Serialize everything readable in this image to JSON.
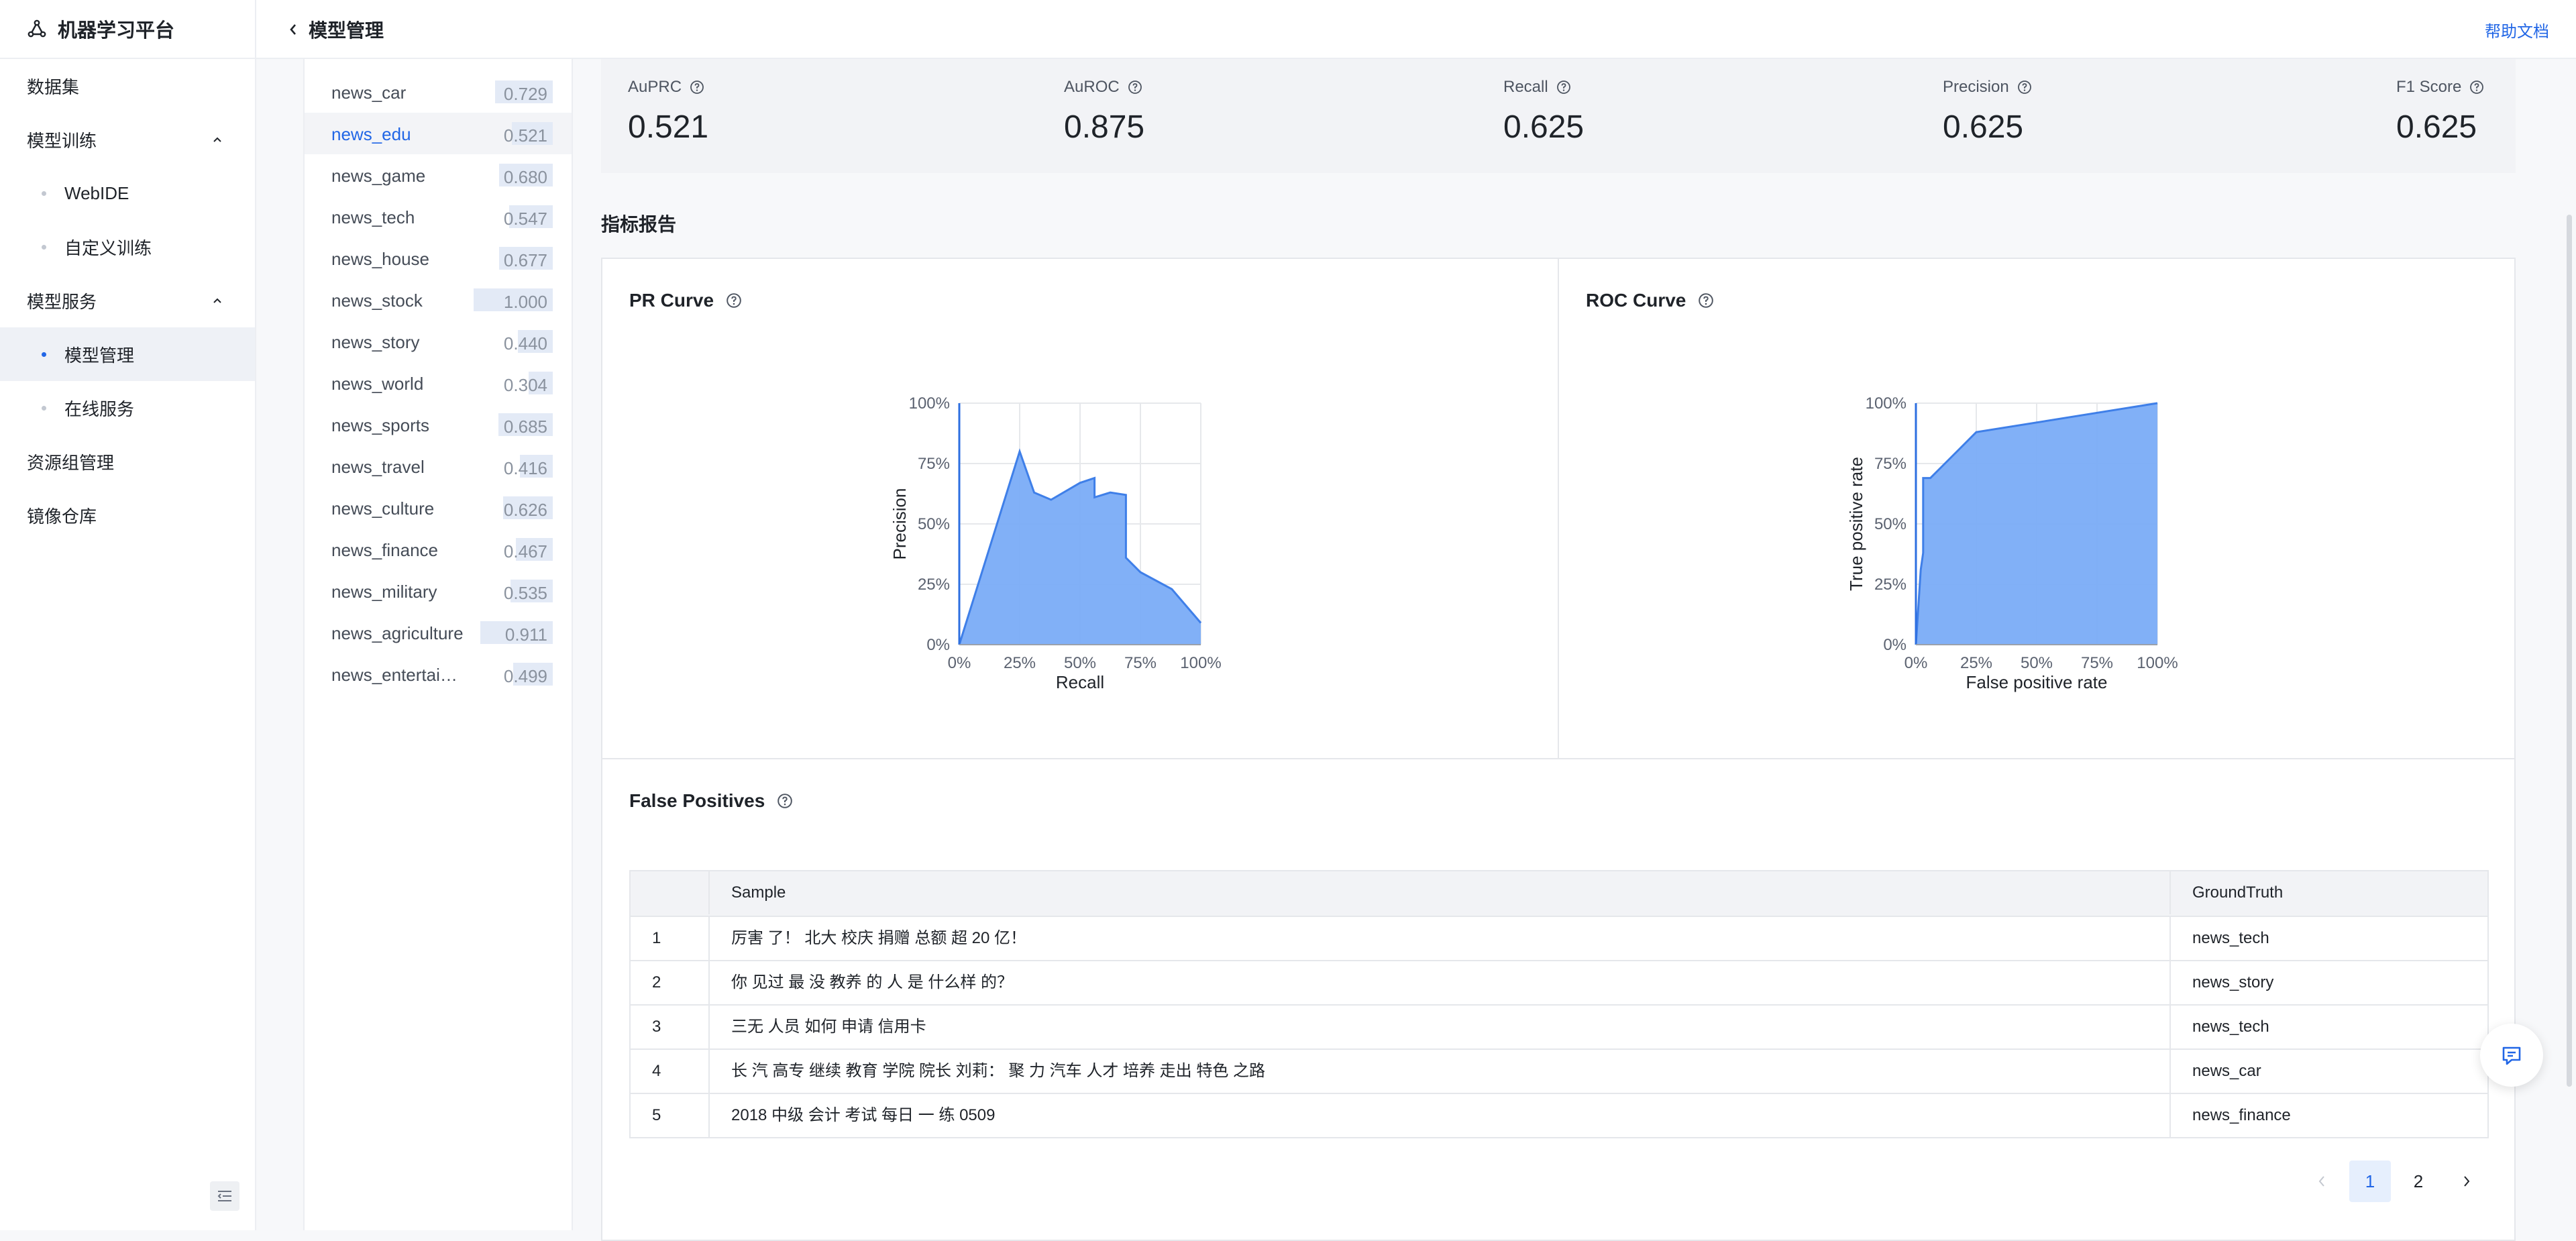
{
  "app": {
    "title": "机器学习平台"
  },
  "nav": {
    "items": [
      {
        "label": "数据集",
        "level": "top"
      },
      {
        "label": "模型训练",
        "level": "top",
        "expanded": true
      },
      {
        "label": "WebIDE",
        "level": "sub"
      },
      {
        "label": "自定义训练",
        "level": "sub"
      },
      {
        "label": "模型服务",
        "level": "top",
        "expanded": true
      },
      {
        "label": "模型管理",
        "level": "sub",
        "active": true
      },
      {
        "label": "在线服务",
        "level": "sub"
      },
      {
        "label": "资源组管理",
        "level": "top"
      },
      {
        "label": "镜像仓库",
        "level": "top"
      }
    ]
  },
  "header": {
    "title": "模型管理",
    "help": "帮助文档"
  },
  "categories": [
    {
      "name": "news_car",
      "value": "0.729"
    },
    {
      "name": "news_edu",
      "value": "0.521",
      "active": true
    },
    {
      "name": "news_game",
      "value": "0.680"
    },
    {
      "name": "news_tech",
      "value": "0.547"
    },
    {
      "name": "news_house",
      "value": "0.677"
    },
    {
      "name": "news_stock",
      "value": "1.000"
    },
    {
      "name": "news_story",
      "value": "0.440"
    },
    {
      "name": "news_world",
      "value": "0.304"
    },
    {
      "name": "news_sports",
      "value": "0.685"
    },
    {
      "name": "news_travel",
      "value": "0.416"
    },
    {
      "name": "news_culture",
      "value": "0.626"
    },
    {
      "name": "news_finance",
      "value": "0.467"
    },
    {
      "name": "news_military",
      "value": "0.535"
    },
    {
      "name": "news_agriculture",
      "value": "0.911"
    },
    {
      "name": "news_entertainment",
      "value": "0.499"
    }
  ],
  "metrics": [
    {
      "label": "AuPRC",
      "value": "0.521"
    },
    {
      "label": "AuROC",
      "value": "0.875"
    },
    {
      "label": "Recall",
      "value": "0.625"
    },
    {
      "label": "Precision",
      "value": "0.625"
    },
    {
      "label": "F1 Score",
      "value": "0.625"
    }
  ],
  "report": {
    "title": "指标报告"
  },
  "pr_card": {
    "title": "PR Curve"
  },
  "roc_card": {
    "title": "ROC Curve"
  },
  "chart_data": [
    {
      "type": "area",
      "title": "PR Curve",
      "xlabel": "Recall",
      "ylabel": "Precision",
      "xlim": [
        0,
        1
      ],
      "ylim": [
        0,
        1
      ],
      "xticks": [
        "0%",
        "25%",
        "50%",
        "75%",
        "100%"
      ],
      "yticks": [
        "0%",
        "25%",
        "50%",
        "75%",
        "100%"
      ],
      "grid": true,
      "color": "#7aacf7",
      "x": [
        0,
        0.25,
        0.31,
        0.38,
        0.5,
        0.56,
        0.56,
        0.625,
        0.69,
        0.69,
        0.75,
        0.88,
        1.0
      ],
      "y": [
        0,
        0.8,
        0.63,
        0.6,
        0.67,
        0.69,
        0.61,
        0.63,
        0.62,
        0.36,
        0.3,
        0.23,
        0.09
      ]
    },
    {
      "type": "area",
      "title": "ROC Curve",
      "xlabel": "False positive rate",
      "ylabel": "True positive rate",
      "xlim": [
        0,
        1
      ],
      "ylim": [
        0,
        1
      ],
      "xticks": [
        "0%",
        "25%",
        "50%",
        "75%",
        "100%"
      ],
      "yticks": [
        "0%",
        "25%",
        "50%",
        "75%",
        "100%"
      ],
      "grid": true,
      "color": "#7aacf7",
      "x": [
        0,
        0.02,
        0.03,
        0.03,
        0.06,
        0.12,
        0.25,
        1.0
      ],
      "y": [
        0,
        0.31,
        0.38,
        0.69,
        0.69,
        0.75,
        0.88,
        1.0
      ]
    }
  ],
  "false_positives": {
    "title": "False Positives",
    "columns": [
      "",
      "Sample",
      "GroundTruth"
    ],
    "rows": [
      {
        "idx": "1",
        "sample": "厉害 了！ 北大 校庆 捐赠 总额 超 20 亿！",
        "gt": "news_tech"
      },
      {
        "idx": "2",
        "sample": "你 见过 最 没 教养 的 人 是 什么样 的？",
        "gt": "news_story"
      },
      {
        "idx": "3",
        "sample": "三无 人员 如何 申请 信用卡",
        "gt": "news_tech"
      },
      {
        "idx": "4",
        "sample": "长 汽 高专 继续 教育 学院 院长 刘莉： 聚 力 汽车 人才 培养 走出 特色 之路",
        "gt": "news_car"
      },
      {
        "idx": "5",
        "sample": "2018 中级 会计 考试 每日 一 练 0509",
        "gt": "news_finance"
      }
    ],
    "pages": [
      "1",
      "2"
    ],
    "current_page": "1"
  }
}
